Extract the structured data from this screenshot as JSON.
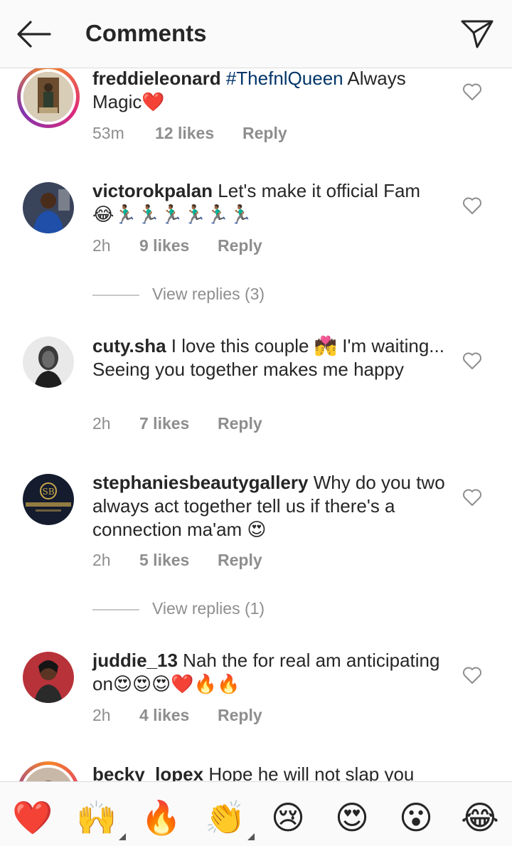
{
  "header": {
    "title": "Comments",
    "back_icon": "arrow-left-icon",
    "share_icon": "paper-plane-icon"
  },
  "comments": [
    {
      "username": "freddieleonard",
      "hashtag": "#ThefnlQueen",
      "text": " Always Magic",
      "emoji": "❤️",
      "time": "53m",
      "likes": "12 likes",
      "reply": "Reply"
    },
    {
      "username": "victorokpalan",
      "text": " Let's make it official Fam",
      "emoji": "😂🏃🏾‍♂️🏃🏾‍♂️🏃🏾‍♂️🏃🏾‍♂️🏃🏾‍♂️🏃🏾‍♂️",
      "time": "2h",
      "likes": "9 likes",
      "reply": "Reply",
      "view_replies": "View replies (3)"
    },
    {
      "username": "cuty.sha",
      "text_a": " I love this couple ",
      "emoji": "💏",
      "text_b": " I'm waiting... Seeing you together makes me happy",
      "time": "2h",
      "likes": "7 likes",
      "reply": "Reply"
    },
    {
      "username": "stephaniesbeautygallery",
      "text": " Why do you two always act together tell us if there's a connection ma'am ",
      "emoji": "😍",
      "time": "2h",
      "likes": "5 likes",
      "reply": "Reply",
      "view_replies": "View replies (1)"
    },
    {
      "username": "juddie_13",
      "text": " Nah the for real am anticipating on",
      "emoji": "😍😍😍❤️🔥🔥",
      "time": "2h",
      "likes": "4 likes",
      "reply": "Reply"
    },
    {
      "username": "becky_lopex",
      "text": " Hope he will not slap you"
    }
  ],
  "emoji_bar": [
    "❤️",
    "🙌",
    "🔥",
    "👏",
    "😢",
    "😍",
    "😮",
    "😂"
  ],
  "colors": {
    "hashtag": "#003569",
    "meta": "#8e8e8e",
    "heart": "#e0245e"
  }
}
